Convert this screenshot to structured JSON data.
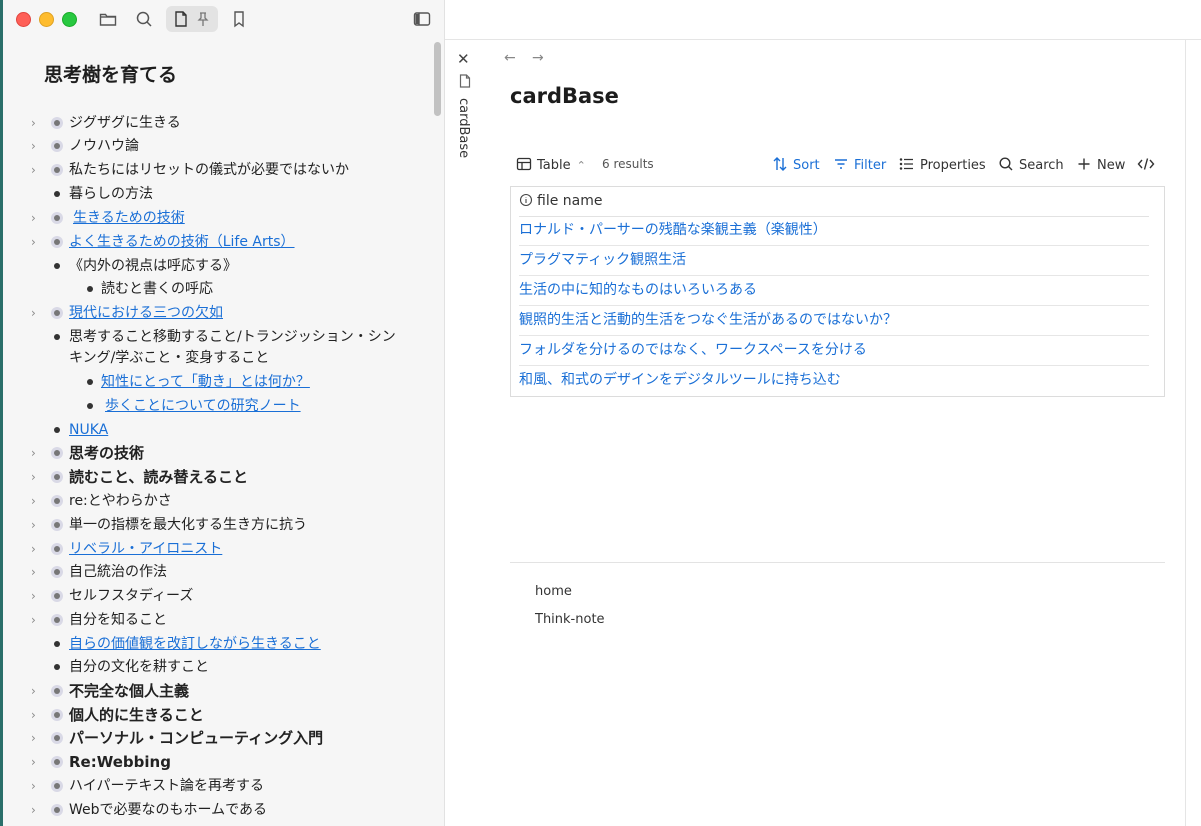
{
  "sidebar": {
    "title": "思考樹を育てる",
    "toolbar": {
      "folder_icon": "folder-icon",
      "search_icon": "search-icon",
      "file_icon": "file-icon",
      "pin_icon": "pin-icon",
      "bookmark_icon": "bookmark-icon",
      "sidebar_toggle_icon": "sidebar-toggle-icon"
    },
    "items": [
      {
        "label": "ジグザグに生きる"
      },
      {
        "label": "ノウハウ論"
      },
      {
        "label": "私たちにはリセットの儀式が必要ではないか"
      },
      {
        "label": "暮らしの方法"
      },
      {
        "label": "生きるための技術"
      },
      {
        "label": "よく生きるための技術（Life Arts）"
      },
      {
        "label": "《内外の視点は呼応する》"
      },
      {
        "label": "読むと書くの呼応"
      },
      {
        "label": "現代における三つの欠如"
      },
      {
        "label": "思考すること移動すること/トランジッション・シン"
      },
      {
        "label": "キング/学ぶこと・変身すること"
      },
      {
        "label": "知性にとって「動き」とは何か？"
      },
      {
        "label": "歩くことについての研究ノート"
      },
      {
        "label": "NUKA"
      },
      {
        "label": "思考の技術"
      },
      {
        "label": "読むこと、読み替えること"
      },
      {
        "label": "re:とやわらかさ"
      },
      {
        "label": "単一の指標を最大化する生き方に抗う"
      },
      {
        "label": "リベラル・アイロニスト"
      },
      {
        "label": "自己統治の作法"
      },
      {
        "label": "セルフスタディーズ"
      },
      {
        "label": "自分を知ること"
      },
      {
        "label": "自らの価値観を改訂しながら生きること"
      },
      {
        "label": "自分の文化を耕すこと"
      },
      {
        "label": "不完全な個人主義"
      },
      {
        "label": "個人的に生きること"
      },
      {
        "label": "パーソナル・コンピューティング入門"
      },
      {
        "label": "Re:Webbing"
      },
      {
        "label": "ハイパーテキスト論を再考する"
      },
      {
        "label": "Webで必要なのもホームである"
      }
    ]
  },
  "tab": {
    "vertical_label": "cardBase",
    "close_icon": "close-icon"
  },
  "main": {
    "title": "cardBase",
    "toolbar": {
      "view_label": "Table",
      "results": "6 results",
      "sort": "Sort",
      "filter": "Filter",
      "properties": "Properties",
      "search": "Search",
      "new": "New"
    },
    "table": {
      "header": "file name",
      "rows": [
        "ロナルド・パーサーの残酷な楽観主義（楽観性）",
        "プラグマティック観照生活",
        "生活の中に知的なものはいろいろある",
        "観照的生活と活動的生活をつなぐ生活があるのではないか？",
        "フォルダを分けるのではなく、ワークスペースを分ける",
        "和風、和式のデザインをデジタルツールに持ち込む"
      ]
    },
    "backlinks": [
      "home",
      "Think-note"
    ]
  },
  "colors": {
    "accent": "#1a6fd6",
    "sidebar_bg": "#f6f6f6"
  }
}
